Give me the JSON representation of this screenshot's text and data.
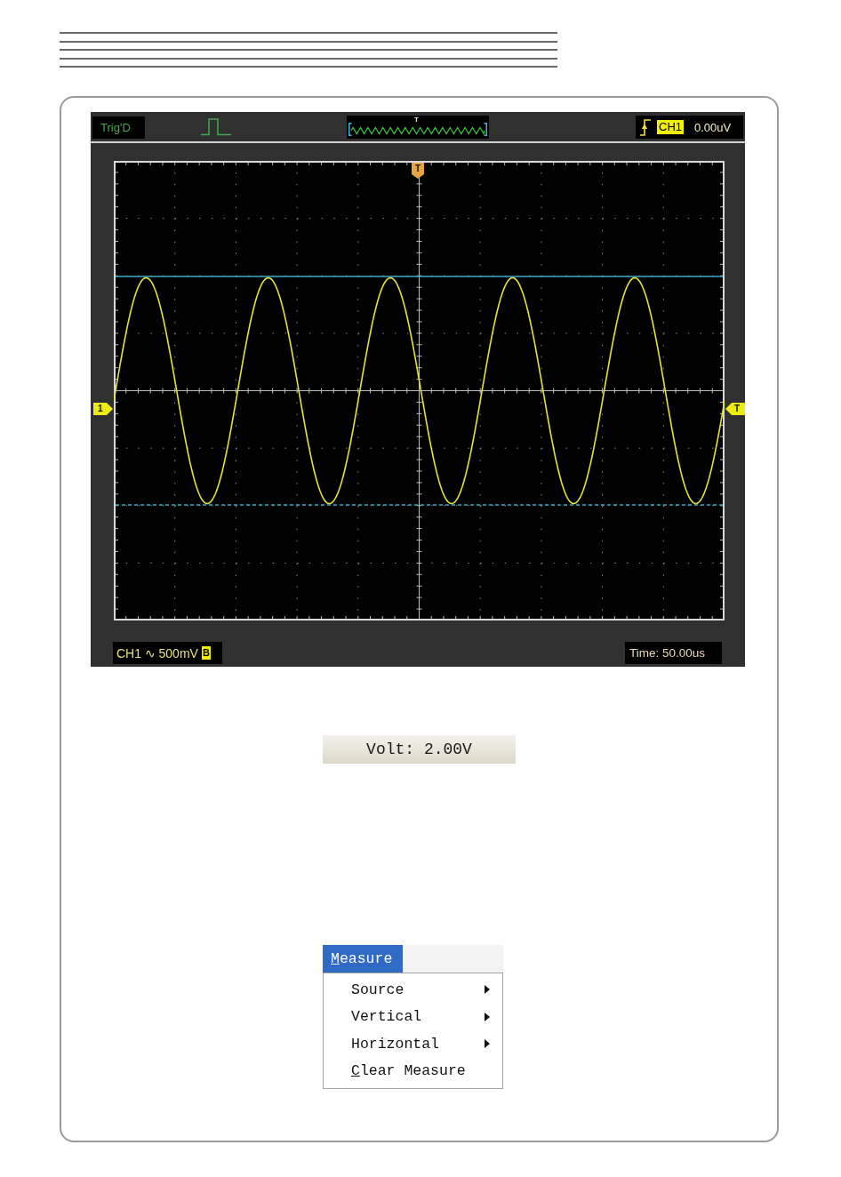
{
  "scope": {
    "status": "Trig'D",
    "overview_marker": "T",
    "trigger": {
      "source": "CH1",
      "reading": "0.00uV"
    },
    "markers": [
      {
        "kind": "trigger_position",
        "label": "T"
      },
      {
        "kind": "channel",
        "label": "1"
      },
      {
        "kind": "trigger_level",
        "label": "T"
      }
    ],
    "channel": {
      "label": "CH1 ∿ 500mV",
      "badge": "B"
    },
    "timebase": "Time: 50.00us"
  },
  "readout": "Volt: 2.00V",
  "menu": {
    "bar": [
      {
        "label": "Measure",
        "selected": true,
        "access_key_underlined": true
      }
    ],
    "items": [
      {
        "label": "Source",
        "submenu": true,
        "access_key_underlined": false,
        "selected": false
      },
      {
        "label": "Vertical",
        "submenu": true,
        "access_key_underlined": false,
        "selected": false
      },
      {
        "label": "Horizontal",
        "submenu": true,
        "access_key_underlined": false,
        "selected": false
      },
      {
        "label": "Clear Measure",
        "submenu": false,
        "access_key_underlined": true,
        "selected": false
      }
    ]
  }
}
